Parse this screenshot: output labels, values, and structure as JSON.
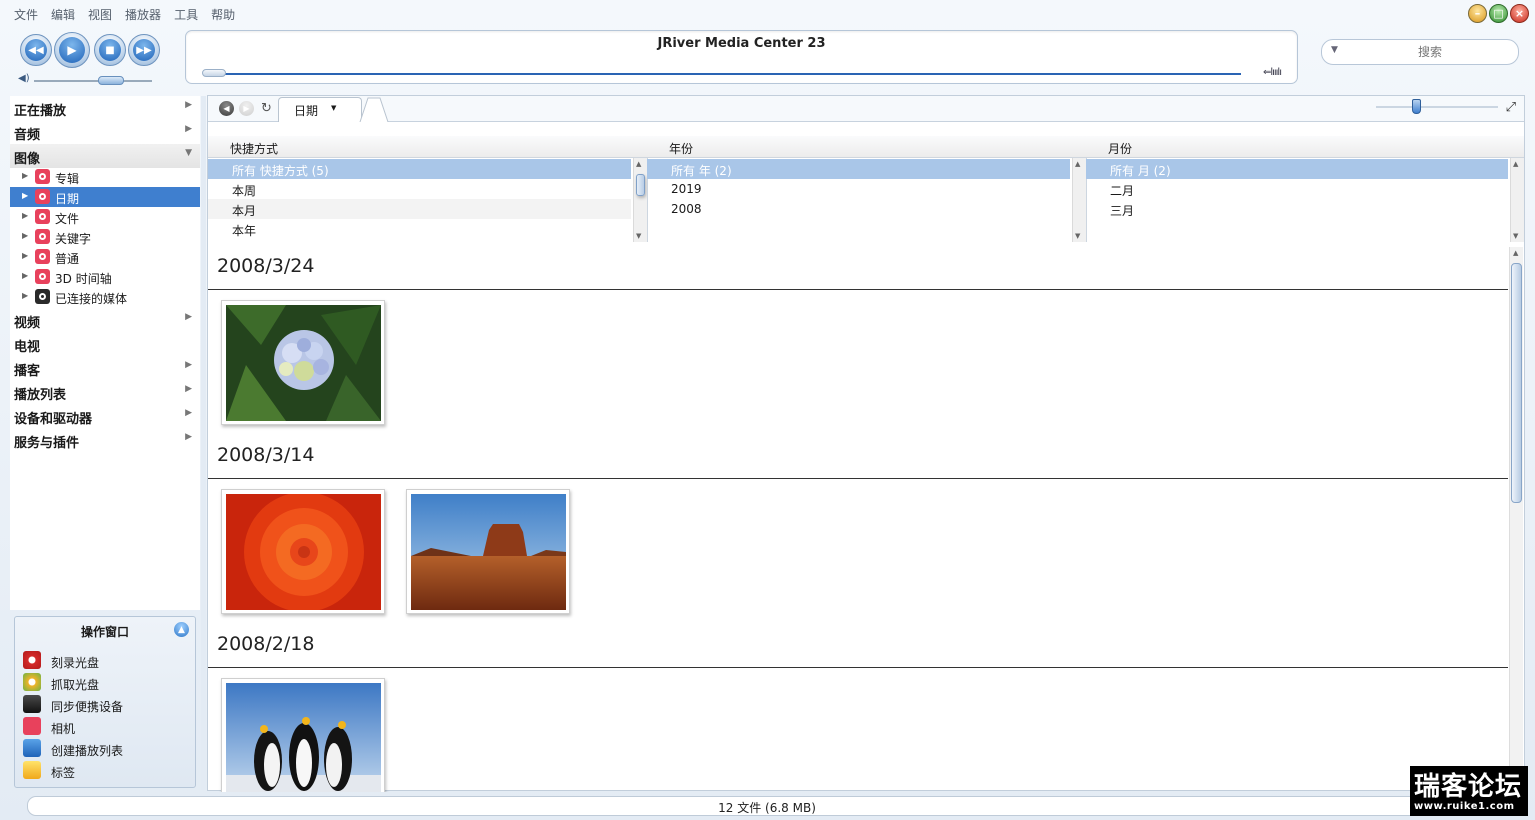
{
  "menu": [
    "文件",
    "编辑",
    "视图",
    "播放器",
    "工具",
    "帮助"
  ],
  "player": {
    "title": "JRiver Media Center 23",
    "dsp_label": "⇐lııılı",
    "volume_level": 0.65,
    "seek_position": 0.0
  },
  "search": {
    "placeholder": "搜索"
  },
  "sidebar": {
    "categories": [
      {
        "label": "正在播放"
      },
      {
        "label": "音频"
      },
      {
        "label": "图像"
      },
      {
        "label": "视频"
      },
      {
        "label": "电视"
      },
      {
        "label": "播客"
      },
      {
        "label": "播放列表"
      },
      {
        "label": "设备和驱动器"
      },
      {
        "label": "服务与插件"
      }
    ],
    "image_children": [
      {
        "label": "专辑"
      },
      {
        "label": "日期"
      },
      {
        "label": "文件"
      },
      {
        "label": "关键字"
      },
      {
        "label": "普通"
      },
      {
        "label": "3D 时间轴"
      },
      {
        "label": "已连接的媒体"
      }
    ],
    "selected_child": "日期"
  },
  "action_window": {
    "title": "操作窗口",
    "items": [
      {
        "label": "刻录光盘",
        "icon": "burn-disc-icon"
      },
      {
        "label": "抓取光盘",
        "icon": "rip-disc-icon"
      },
      {
        "label": "同步便携设备",
        "icon": "sync-device-icon"
      },
      {
        "label": "相机",
        "icon": "camera-icon"
      },
      {
        "label": "创建播放列表",
        "icon": "playlist-icon"
      },
      {
        "label": "标签",
        "icon": "tag-icon"
      }
    ]
  },
  "view": {
    "tab_label": "日期",
    "zoom_level": 0.33
  },
  "panes": [
    {
      "header": "快捷方式",
      "rows": [
        "所有 快捷方式 (5)",
        "本周",
        "本月",
        "本年"
      ]
    },
    {
      "header": "年份",
      "rows": [
        "所有 年 (2)",
        "2019",
        "2008"
      ]
    },
    {
      "header": "月份",
      "rows": [
        "所有 月 (2)",
        "二月",
        "三月"
      ]
    }
  ],
  "gallery": {
    "groups": [
      {
        "date": "2008/3/24",
        "photos": [
          "hydrangea"
        ]
      },
      {
        "date": "2008/3/14",
        "photos": [
          "chrysanthemum",
          "desert"
        ]
      },
      {
        "date": "2008/2/18",
        "photos": [
          "penguins"
        ]
      }
    ]
  },
  "status": {
    "text": "12 文件 (6.8 MB)"
  },
  "watermark": {
    "line1": "瑞客论坛",
    "line2": "www.ruike1.com"
  }
}
